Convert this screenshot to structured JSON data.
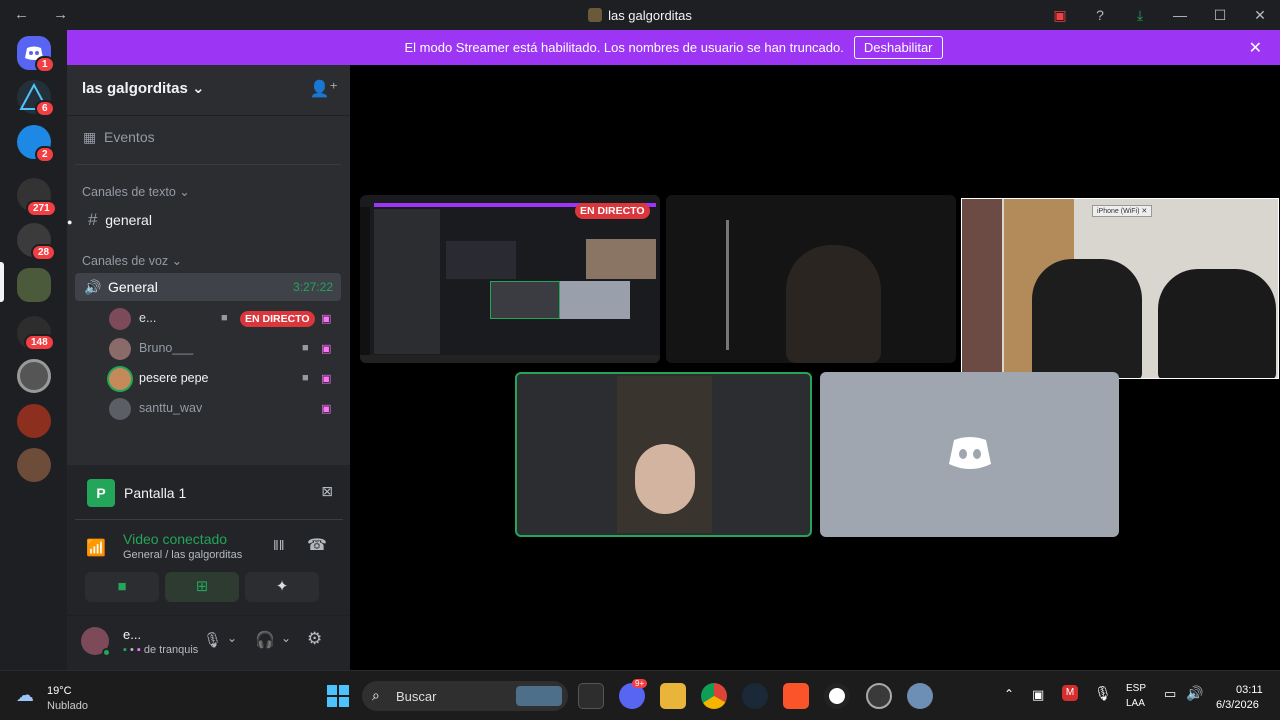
{
  "window": {
    "title": "las galgorditas",
    "nav": "← →",
    "controls": {
      "minimize": "—",
      "maximize": "☐",
      "close": "✕"
    }
  },
  "rail": {
    "badges": [
      "1",
      "6",
      "2",
      "271",
      "28",
      "148"
    ]
  },
  "banner": {
    "text": "El modo Streamer está habilitado. Los nombres de usuario se han truncado.",
    "button": "Deshabilitar"
  },
  "sidebar": {
    "server_name": "las galgorditas",
    "events_label": "Eventos",
    "text_category": "Canales de texto",
    "text_channel": "general",
    "voice_category": "Canales de voz",
    "voice_channel": "General",
    "voice_timer": "3:27:22",
    "members": [
      {
        "name": "e...",
        "live": "EN DIRECTO"
      },
      {
        "name": "Bruno___"
      },
      {
        "name": "pesere pepe"
      },
      {
        "name": "santtu_wav"
      }
    ]
  },
  "panel": {
    "screen_label": "Pantalla 1",
    "screen_icon": "P",
    "status": "Video conectado",
    "status_sub": "General / las galgorditas",
    "user_name": "e...",
    "user_status": "de tranquis"
  },
  "stage": {
    "live_badge": "EN DIRECTO",
    "preview_label": "iPhone (WiFi)"
  },
  "taskbar": {
    "weather_temp": "19°C",
    "weather_desc": "Nublado",
    "search_placeholder": "Buscar",
    "lang": "ESP",
    "lang_sub": "LAA",
    "time": "03:11",
    "date": "6/3/2026",
    "discord_badge": "9+"
  },
  "colors": {
    "banner": "#9d35f5",
    "live": "#da373c",
    "green": "#23a55a",
    "blurple": "#5865f2"
  }
}
